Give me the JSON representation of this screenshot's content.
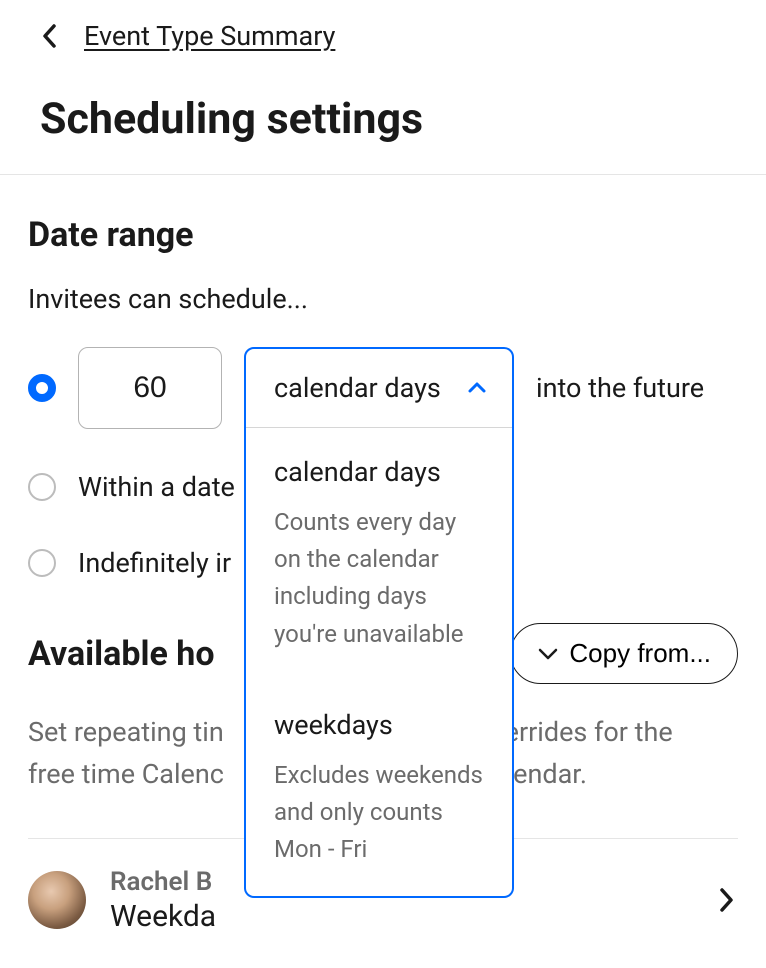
{
  "breadcrumb": {
    "back_label": "Event Type Summary"
  },
  "page_title": "Scheduling settings",
  "date_range": {
    "title": "Date range",
    "subtitle": "Invitees can schedule...",
    "options": [
      {
        "days_value": "60",
        "unit_selected": "calendar days",
        "suffix": "into the future",
        "selected": true
      },
      {
        "label": "Within a date"
      },
      {
        "label": "Indefinitely ir"
      }
    ],
    "unit_dropdown": [
      {
        "title": "calendar days",
        "description": "Counts every day on the calendar including days you're unavailable"
      },
      {
        "title": "weekdays",
        "description": "Excludes weekends and only counts Mon - Fri"
      }
    ]
  },
  "available_hours": {
    "title": "Available ho",
    "copy_button": "Copy from...",
    "description_line1": "Set repeating tin",
    "description_line2": "free time Calenc",
    "description_line1_right": "verrides for the",
    "description_line2_right": "alendar."
  },
  "person": {
    "name": "Rachel B",
    "schedule": "Weekda"
  }
}
